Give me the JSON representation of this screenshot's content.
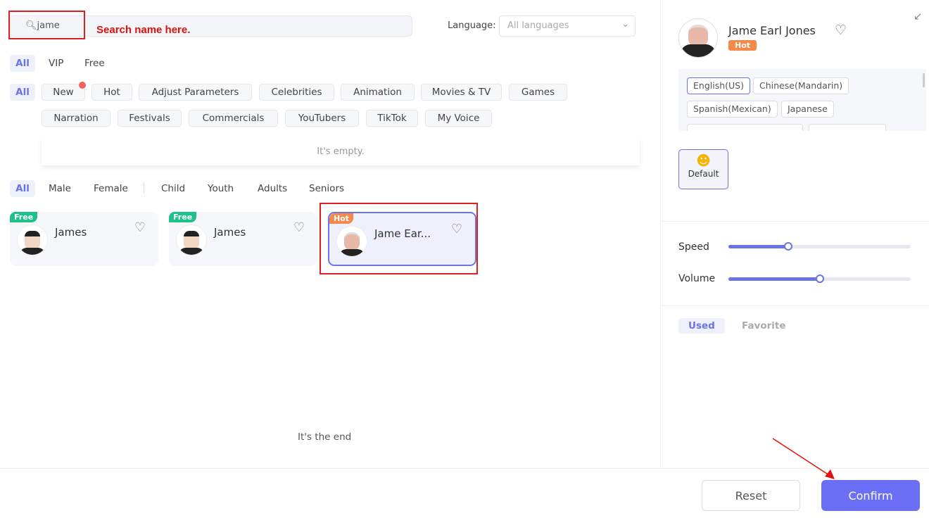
{
  "search": {
    "value": "jame",
    "annotation": "Search name here."
  },
  "language": {
    "label": "Language:",
    "selected": "All languages"
  },
  "tier_filters": [
    "All",
    "VIP",
    "Free"
  ],
  "category_filters": [
    "All",
    "New",
    "Hot",
    "Adjust Parameters",
    "Celebrities",
    "Animation",
    "Movies & TV",
    "Games",
    "Narration",
    "Festivals",
    "Commercials",
    "YouTubers",
    "TikTok",
    "My Voice"
  ],
  "empty_text": "It's empty.",
  "demographic_filters": [
    "All",
    "Male",
    "Female",
    "Child",
    "Youth",
    "Adults",
    "Seniors"
  ],
  "voices": [
    {
      "name": "James",
      "badge": "Free",
      "badge_color": "#1fc18a"
    },
    {
      "name": "James",
      "badge": "Free",
      "badge_color": "#1fc18a"
    },
    {
      "name": "Jame Ear...",
      "badge": "Hot",
      "badge_color": "#f5894a",
      "selected": true
    }
  ],
  "end_text": "It's the end",
  "detail": {
    "name": "Jame Earl Jones",
    "badge": "Hot",
    "languages": [
      "English(US)",
      "Chinese(Mandarin)",
      "Spanish(Mexican)",
      "Japanese"
    ],
    "style": "Default",
    "speed_label": "Speed",
    "speed_value": 0.33,
    "volume_label": "Volume",
    "volume_value": 0.5,
    "tabs": [
      "Used",
      "Favorite"
    ]
  },
  "buttons": {
    "reset": "Reset",
    "confirm": "Confirm"
  },
  "colors": {
    "accent": "#6a74e6",
    "annotation": "#e01010"
  }
}
